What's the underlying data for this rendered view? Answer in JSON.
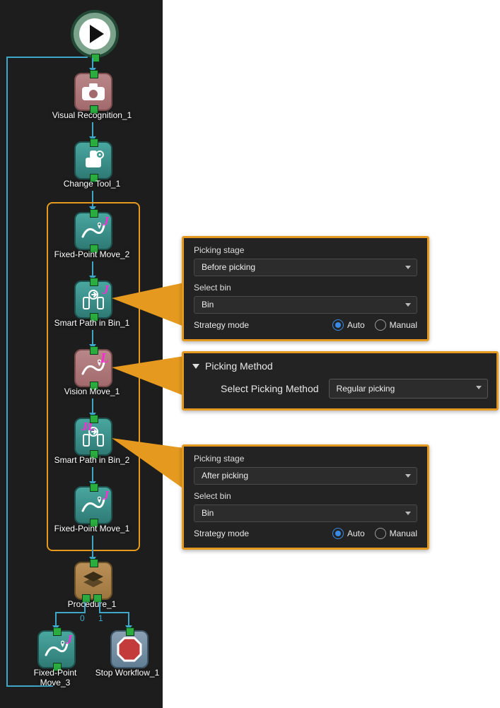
{
  "nodes": {
    "start": {
      "label": ""
    },
    "visual": {
      "label": "Visual Recognition_1"
    },
    "change_tool": {
      "label": "Change Tool_1"
    },
    "fixed2": {
      "label": "Fixed-Point Move_2",
      "tag": "J"
    },
    "smart1": {
      "label": "Smart Path in Bin_1",
      "tag": "J"
    },
    "vision_move": {
      "label": "Vision Move_1",
      "tag": "L"
    },
    "smart2": {
      "label": "Smart Path in Bin_2",
      "tag": "J/L"
    },
    "fixed1": {
      "label": "Fixed-Point Move_1",
      "tag": "J"
    },
    "procedure": {
      "label": "Procedure_1"
    },
    "fixed3": {
      "label": "Fixed-Point Move_3",
      "tag": "J"
    },
    "stop": {
      "label": "Stop Workflow_1"
    },
    "branch_left": "0",
    "branch_right": "1"
  },
  "panel_smart1": {
    "picking_stage_label": "Picking stage",
    "picking_stage_value": "Before picking",
    "select_bin_label": "Select bin",
    "select_bin_value": "Bin",
    "strategy_label": "Strategy mode",
    "strategy_options": {
      "auto": "Auto",
      "manual": "Manual"
    },
    "strategy_selected": "auto"
  },
  "panel_vision": {
    "section_title": "Picking Method",
    "select_label": "Select Picking Method",
    "select_value": "Regular picking"
  },
  "panel_smart2": {
    "picking_stage_label": "Picking stage",
    "picking_stage_value": "After picking",
    "select_bin_label": "Select bin",
    "select_bin_value": "Bin",
    "strategy_label": "Strategy mode",
    "strategy_options": {
      "auto": "Auto",
      "manual": "Manual"
    },
    "strategy_selected": "auto"
  }
}
